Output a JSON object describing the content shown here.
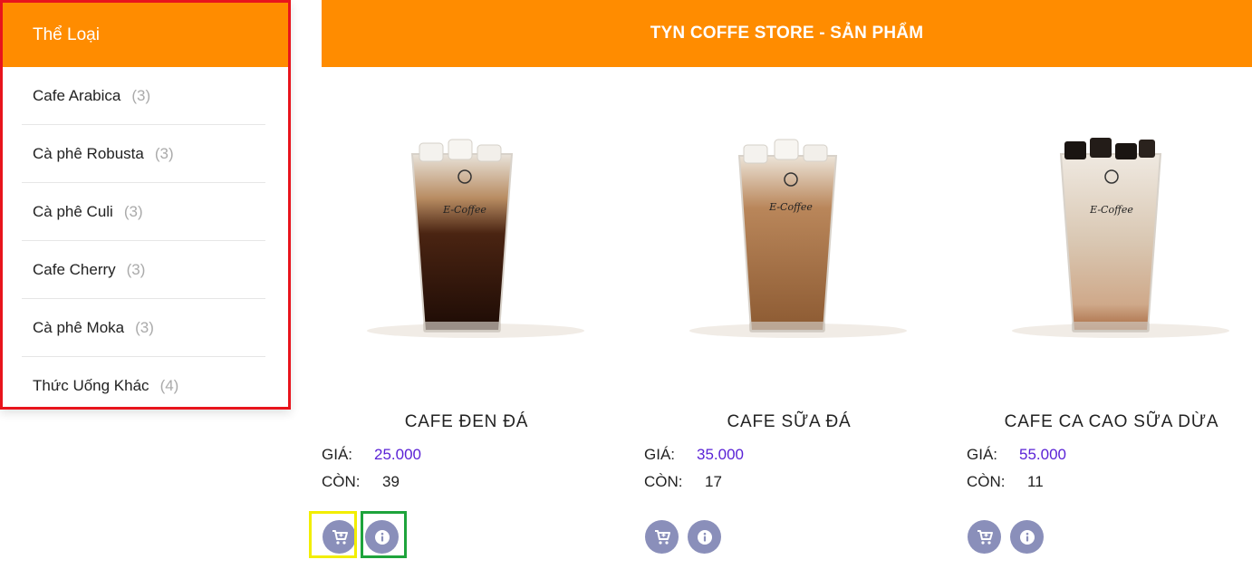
{
  "sidebar": {
    "title": "Thể Loại",
    "items": [
      {
        "label": "Cafe Arabica",
        "count": "(3)"
      },
      {
        "label": "Cà phê Robusta",
        "count": "(3)"
      },
      {
        "label": "Cà phê Culi",
        "count": "(3)"
      },
      {
        "label": "Cafe Cherry",
        "count": "(3)"
      },
      {
        "label": "Cà phê Moka",
        "count": "(3)"
      },
      {
        "label": "Thức Uống Khác",
        "count": "(4)"
      }
    ]
  },
  "header": {
    "title": "TYN COFFE STORE - SẢN PHẨM"
  },
  "labels": {
    "price": "GIÁ:",
    "stock": "CÒN:"
  },
  "products": [
    {
      "name": "CAFE ĐEN ĐÁ",
      "price": "25.000",
      "stock": "39"
    },
    {
      "name": "CAFE SỮA ĐÁ",
      "price": "35.000",
      "stock": "17"
    },
    {
      "name": "CAFE CA CAO SỮA DỪA",
      "price": "55.000",
      "stock": "11"
    }
  ],
  "icons": {
    "cart": "add-to-cart-icon",
    "info": "info-icon"
  },
  "colors": {
    "accent": "#ff8c00",
    "price": "#5a22d6",
    "button": "#8a8fba",
    "highlight_sidebar": "#e8141c",
    "highlight_cart": "#f2ee00",
    "highlight_info": "#1ea43c"
  }
}
